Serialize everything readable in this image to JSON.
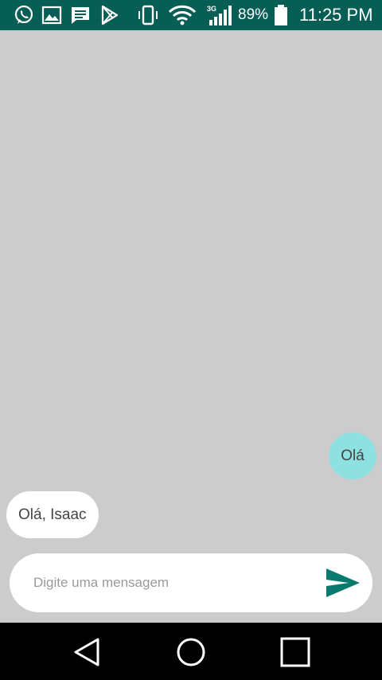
{
  "status_bar": {
    "icons": [
      "whatsapp-icon",
      "image-icon",
      "message-icon",
      "play-store-icon",
      "vibrate-icon",
      "wifi-icon",
      "signal-3g-icon",
      "battery-icon"
    ],
    "network_label": "3G",
    "battery_percent": "89%",
    "time": "11:25 PM",
    "background_color": "#075e54"
  },
  "chat": {
    "background_color": "#cccccc",
    "messages": [
      {
        "direction": "outgoing",
        "text": "Olá",
        "color": "#8fe0e0"
      },
      {
        "direction": "incoming",
        "text": "Olá, Isaac",
        "color": "#ffffff"
      }
    ]
  },
  "composer": {
    "placeholder": "Digite uma mensagem",
    "value": "",
    "send_icon": "send-icon",
    "send_color": "#0a7a6e"
  },
  "nav_bar": {
    "buttons": [
      "back-icon",
      "home-icon",
      "recents-icon"
    ]
  }
}
